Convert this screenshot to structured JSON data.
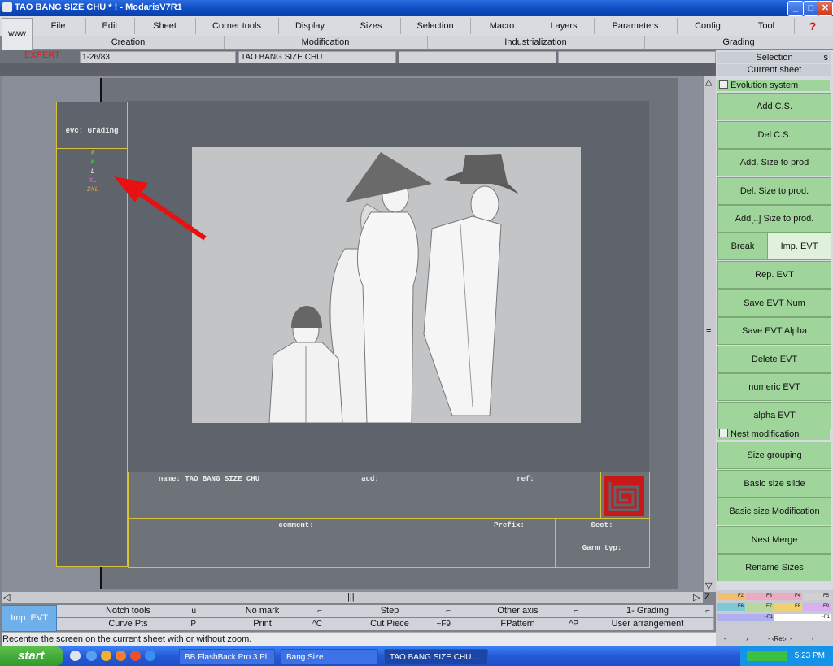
{
  "window": {
    "title": "TAO BANG SIZE CHU * ! - ModarisV7R1"
  },
  "menubar": {
    "www": "www",
    "items": [
      "File",
      "Edit",
      "Sheet",
      "Corner tools",
      "Display",
      "Sizes",
      "Selection",
      "Macro",
      "Layers",
      "Parameters",
      "Config",
      "Tool"
    ],
    "help": "?"
  },
  "submenu": {
    "items": [
      "Creation",
      "Modification",
      "Industrialization",
      "Grading"
    ]
  },
  "status": {
    "mode": "EXPERT",
    "field1": "1-26/83",
    "field2": "TAO BANG SIZE CHU",
    "field3": "",
    "field4": ""
  },
  "right_panel": {
    "selection": "Selection",
    "selection_key": "s",
    "current_sheet": "Current sheet",
    "evolution_system": "Evolution system",
    "buttons1": [
      "Add C.S.",
      "Del C.S.",
      "Add. Size to prod",
      "Del. Size to prod.",
      "Add[..] Size to prod."
    ],
    "break": "Break",
    "imp_evt": "Imp. EVT",
    "buttons2": [
      "Rep. EVT",
      "Save EVT Num",
      "Save EVT Alpha",
      "Delete EVT",
      "numeric EVT",
      "alpha EVT"
    ],
    "nest_modification": "Nest modification",
    "buttons3": [
      "Size grouping",
      "Basic size slide",
      "Basic size Modification",
      "Nest Merge",
      "Rename Sizes"
    ]
  },
  "sheet": {
    "evc_label": "evc: Grading",
    "sizes": [
      "S",
      "M",
      "L",
      "XL",
      "2XL"
    ],
    "size_colors": [
      "#e8d43a",
      "#38d838",
      "#ffffff",
      "#e070e0",
      "#f0a030"
    ],
    "name_label": "name: TAO BANG SIZE CHU",
    "acd_label": "acd:",
    "ref_label": "ref:",
    "comment_label": "comment:",
    "prefix_label": "Prefix:",
    "sect_label": "Sect:",
    "garm_label": "Garm typ:"
  },
  "bottom": {
    "imp_evt": "Imp. EVT",
    "row1": [
      {
        "label": "Notch tools",
        "key": "u"
      },
      {
        "label": "No mark",
        "key": "⌐"
      },
      {
        "label": "Step",
        "key": "⌐"
      },
      {
        "label": "Other axis",
        "key": "⌐"
      },
      {
        "label": "1- Grading",
        "key": "⌐"
      }
    ],
    "row2": [
      {
        "label": "Curve Pts",
        "key": "P"
      },
      {
        "label": "Print",
        "key": "^C"
      },
      {
        "label": "Cut Piece",
        "key": "~F9"
      },
      {
        "label": "FPattern",
        "key": "^P"
      },
      {
        "label": "User arrangement",
        "key": ""
      }
    ],
    "status_message": "Recentre the screen on the current sheet with or without zoom.",
    "evt_chips": [
      "F2",
      "F3",
      "F4",
      "F5",
      "F6",
      "F7",
      "F8",
      "F9",
      "~F1",
      "~F1"
    ],
    "nav": [
      "-",
      "›",
      "- ‹Ret›",
      "-",
      "‹"
    ]
  },
  "scroll": {
    "up": "△",
    "down": "▽",
    "mid": "≡",
    "left": "◁",
    "right": "▷",
    "z": "Z"
  },
  "taskbar": {
    "start": "start",
    "tasks": [
      "BB FlashBack Pro 3 Pl...",
      "Bang Size",
      "TAO BANG SIZE CHU ..."
    ],
    "clock": "5:23 PM"
  }
}
